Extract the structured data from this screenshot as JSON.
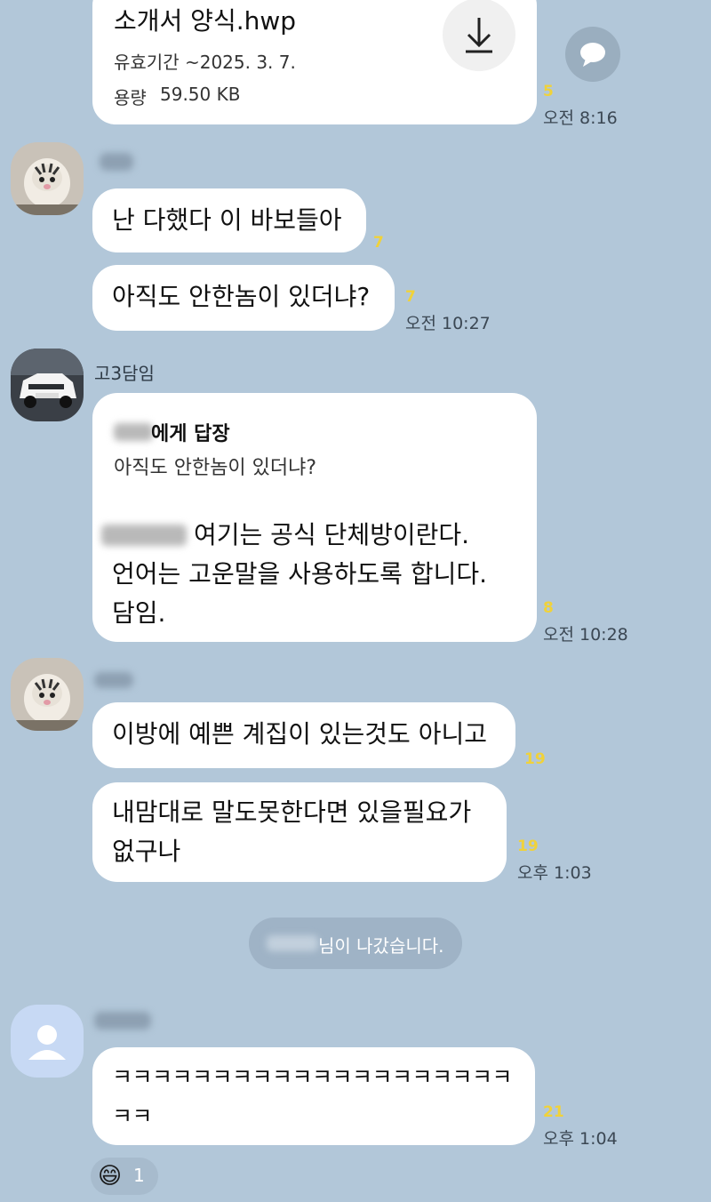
{
  "file_message": {
    "file_name": "소개서 양식.hwp",
    "expiry": "유효기간 ~2025. 3. 7.",
    "size_label": "용량",
    "size_value": "59.50 KB",
    "unread": "5",
    "time": "오전 8:16",
    "download_icon": "download-icon",
    "side_icon": "speech-bubble-icon"
  },
  "group1": {
    "sender_name": "",
    "messages": [
      {
        "text": "난 다했다 이 바보들아",
        "unread": "7",
        "time": ""
      },
      {
        "text": "아직도 안한놈이 있더냐?",
        "unread": "7",
        "time": "오전 10:27"
      }
    ]
  },
  "group2": {
    "sender_name": "고3담임",
    "reply": {
      "to_suffix": "에게 답장",
      "quoted": "아직도 안한놈이 있더냐?"
    },
    "text": "여기는 공식 단체방이란다.\n언어는 고운말을 사용하도록 합니다.\n담임.",
    "unread": "8",
    "time": "오전 10:28"
  },
  "group3": {
    "sender_name": "",
    "messages": [
      {
        "text": "이방에 예쁜 계집이 있는것도 아니고",
        "unread": "19",
        "time": ""
      },
      {
        "text": "내맘대로 말도못한다면 있을필요가\n없구나",
        "unread": "19",
        "time": "오후 1:03"
      }
    ]
  },
  "system_notice": {
    "text": "님이 나갔습니다."
  },
  "group4": {
    "sender_name": "",
    "text": "ㅋㅋㅋㅋㅋㅋㅋㅋㅋㅋㅋㅋㅋㅋㅋㅋㅋㅋㅋㅋ\nㅋㅋ",
    "unread": "21",
    "time": "오후 1:04",
    "reaction_emoji": "😄",
    "reaction_count": "1"
  },
  "colors": {
    "background": "#b2c7d9",
    "bubble": "#ffffff",
    "unread": "#f0d23a"
  }
}
